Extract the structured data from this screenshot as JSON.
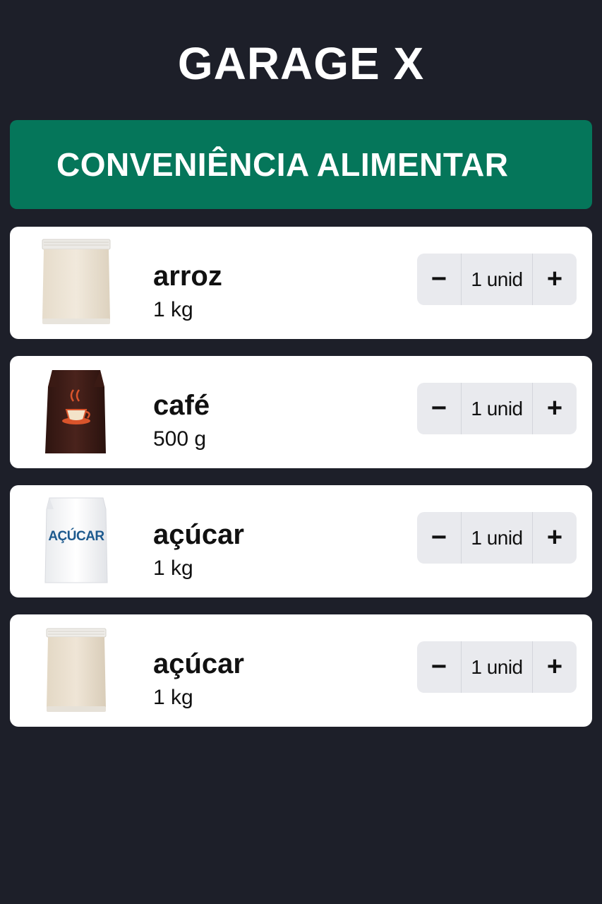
{
  "header": {
    "title": "GARAGE X"
  },
  "category": {
    "label": "CONVENIÊNCIA ALIMENTAR",
    "color": "#05765a"
  },
  "icons": {
    "decrement": "−",
    "increment": "+"
  },
  "products": [
    {
      "name": "arroz",
      "size": "1 kg",
      "quantity": "1 unid",
      "image_icon": "rice-bag-icon"
    },
    {
      "name": "café",
      "size": "500 g",
      "quantity": "1 unid",
      "image_icon": "coffee-bag-icon"
    },
    {
      "name": "açúcar",
      "size": "1 kg",
      "quantity": "1 unid",
      "image_icon": "sugar-bag-icon",
      "package_label": "AÇÚCAR"
    },
    {
      "name": "açúcar",
      "size": "1 kg",
      "quantity": "1 unid",
      "image_icon": "grain-bag-icon"
    }
  ]
}
